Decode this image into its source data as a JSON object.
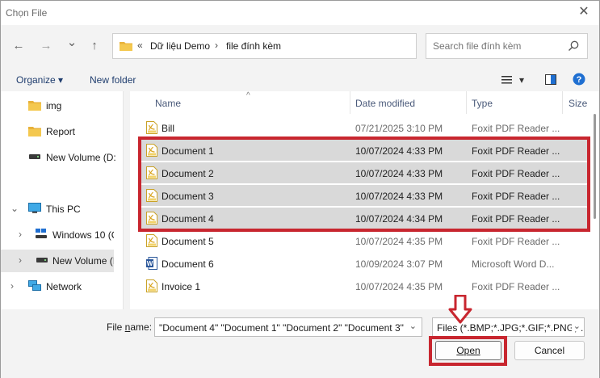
{
  "window": {
    "title": "Chọn File",
    "close_glyph": "✕"
  },
  "nav": {
    "back_glyph": "←",
    "forward_glyph": "→",
    "recent_glyph": "⌄",
    "up_glyph": "↑",
    "breadcrumb_prefix": "«",
    "breadcrumb": [
      "Dữ liệu Demo",
      "file đính kèm"
    ],
    "breadcrumb_sep": "›",
    "search_placeholder": "Search file đính kèm"
  },
  "toolbar": {
    "organize": "Organize",
    "organize_caret": "▾",
    "new_folder": "New folder",
    "view_caret": "▾",
    "help": "?"
  },
  "sidebar": {
    "items": [
      {
        "label": "img",
        "icon": "folder-icon"
      },
      {
        "label": "Report",
        "icon": "folder-icon"
      },
      {
        "label": "New Volume (D:",
        "icon": "drive-icon"
      },
      {
        "label": "This PC",
        "icon": "pc-icon",
        "chevron": "⌄"
      },
      {
        "label": "Windows 10 (C",
        "icon": "windows-drive-icon",
        "chevron": "›"
      },
      {
        "label": "New Volume (I",
        "icon": "drive-icon",
        "chevron": "›",
        "selected": true
      },
      {
        "label": "Network",
        "icon": "network-icon",
        "chevron": "›"
      }
    ]
  },
  "columns": {
    "name": "Name",
    "date": "Date modified",
    "type": "Type",
    "size": "Size",
    "sort_glyph": "^"
  },
  "files": [
    {
      "name": "Bill",
      "date": "07/21/2025 3:10 PM",
      "type": "Foxit PDF Reader ...",
      "icon": "pdf-icon",
      "selected": false
    },
    {
      "name": "Document 1",
      "date": "10/07/2024 4:33 PM",
      "type": "Foxit PDF Reader ...",
      "icon": "pdf-icon",
      "selected": true
    },
    {
      "name": "Document 2",
      "date": "10/07/2024 4:33 PM",
      "type": "Foxit PDF Reader ...",
      "icon": "pdf-icon",
      "selected": true
    },
    {
      "name": "Document 3",
      "date": "10/07/2024 4:33 PM",
      "type": "Foxit PDF Reader ...",
      "icon": "pdf-icon",
      "selected": true
    },
    {
      "name": "Document 4",
      "date": "10/07/2024 4:34 PM",
      "type": "Foxit PDF Reader ...",
      "icon": "pdf-icon",
      "selected": true
    },
    {
      "name": "Document 5",
      "date": "10/07/2024 4:35 PM",
      "type": "Foxit PDF Reader ...",
      "icon": "pdf-icon",
      "selected": false
    },
    {
      "name": "Document 6",
      "date": "10/09/2024 3:07 PM",
      "type": "Microsoft Word D...",
      "icon": "word-icon",
      "selected": false
    },
    {
      "name": "Invoice 1",
      "date": "10/07/2024 4:35 PM",
      "type": "Foxit PDF Reader ...",
      "icon": "pdf-icon",
      "selected": false
    }
  ],
  "bottom": {
    "file_name_label": "File name:",
    "file_name_value": "\"Document 4\" \"Document 1\" \"Document 2\" \"Document 3\"",
    "filter_value": "Files (*.BMP;*.JPG;*.GIF;*.PNG;*.",
    "dropdown_glyph": "⌄",
    "open": "Open",
    "cancel": "Cancel"
  },
  "colors": {
    "highlight": "#c8262f",
    "selection": "#d9d9d9",
    "link": "#1f3d6e"
  }
}
